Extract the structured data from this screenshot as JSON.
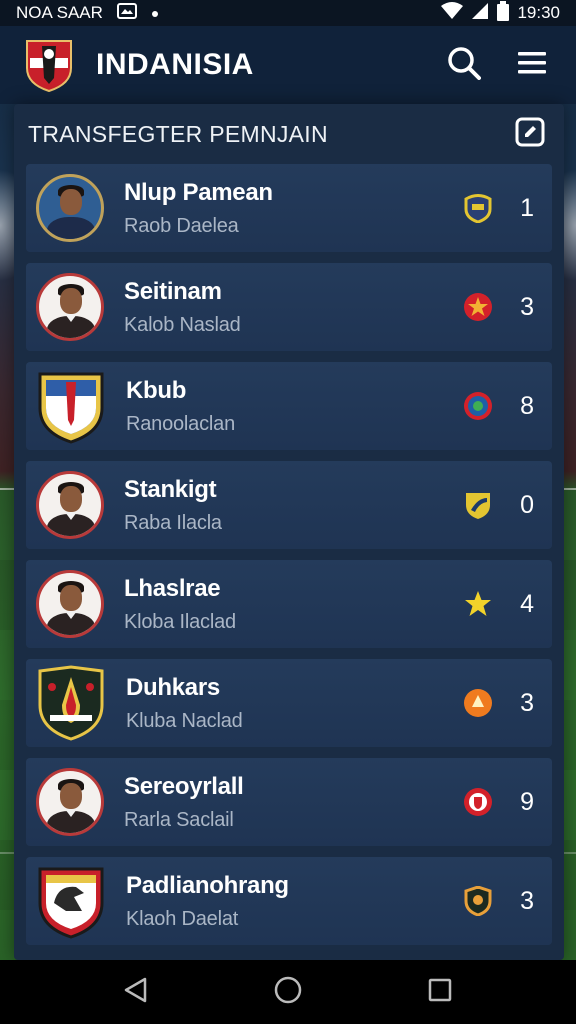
{
  "status_bar": {
    "carrier": "NOA SAAR",
    "time": "19:30"
  },
  "header": {
    "title": "INDANISIA",
    "search_icon": "search-icon",
    "menu_icon": "hamburger-menu-icon"
  },
  "panel": {
    "title": "TRANSFEGTER PEMNJAIN",
    "edit_icon": "edit-icon"
  },
  "transfers": [
    {
      "name": "Nlup Pamean",
      "club": "Raob Daelea",
      "badge": "shield-badge",
      "count": "1"
    },
    {
      "name": "Seitinam",
      "club": "Kalob Naslad",
      "badge": "red-star-badge",
      "count": "3"
    },
    {
      "name": "Kbub",
      "club": "Ranoolaclan",
      "badge": "round-crest-badge",
      "count": "8"
    },
    {
      "name": "Stankigt",
      "club": "Raba Ilacla",
      "badge": "yellow-shield-badge",
      "count": "0"
    },
    {
      "name": "Lhaslrae",
      "club": "Kloba Ilaclad",
      "badge": "star-badge",
      "count": "4"
    },
    {
      "name": "Duhkars",
      "club": "Kluba Naclad",
      "badge": "orange-badge",
      "count": "3"
    },
    {
      "name": "Sereoyrlall",
      "club": "Rarla Saclail",
      "badge": "red-crest-badge",
      "count": "9"
    },
    {
      "name": "Padlianohrang",
      "club": "Klaoh Daelat",
      "badge": "orange-shield-badge",
      "count": "3"
    }
  ]
}
